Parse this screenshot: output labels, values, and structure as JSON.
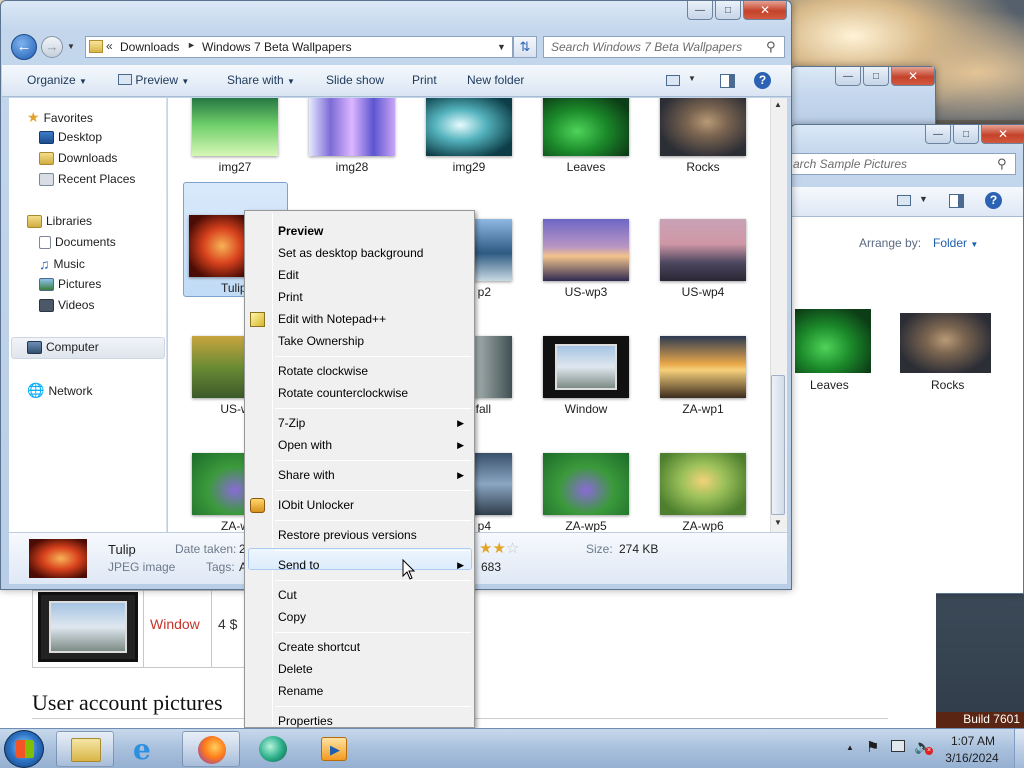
{
  "explorer": {
    "breadcrumb": [
      "Downloads",
      "Windows 7 Beta Wallpapers"
    ],
    "search_placeholder": "Search Windows 7 Beta Wallpapers",
    "toolbar": {
      "organize": "Organize",
      "preview": "Preview",
      "share_with": "Share with",
      "slide_show": "Slide show",
      "print": "Print",
      "new_folder": "New folder"
    },
    "nav": {
      "favorites": "Favorites",
      "desktop": "Desktop",
      "downloads": "Downloads",
      "recent_places": "Recent Places",
      "libraries": "Libraries",
      "documents": "Documents",
      "music": "Music",
      "pictures": "Pictures",
      "videos": "Videos",
      "computer": "Computer",
      "network": "Network"
    },
    "files": [
      {
        "name": "img27"
      },
      {
        "name": "img28"
      },
      {
        "name": "img29"
      },
      {
        "name": "Leaves"
      },
      {
        "name": "Rocks"
      },
      {
        "name": "Tulip"
      },
      {
        "name": "US-wp2"
      },
      {
        "name": "US-wp3"
      },
      {
        "name": "US-wp4"
      },
      {
        "name": "US-wp"
      },
      {
        "name": "US-waterfall"
      },
      {
        "name": "Window"
      },
      {
        "name": "ZA-wp1"
      },
      {
        "name": "ZA-wp"
      },
      {
        "name": "ZA-wp4"
      },
      {
        "name": "ZA-wp5"
      },
      {
        "name": "ZA-wp6"
      }
    ],
    "labels_visible": {
      "img27": "img27",
      "img28": "img28",
      "img29": "img29",
      "leaves": "Leaves",
      "rocks": "Rocks",
      "tulip": "Tulip",
      "uswp2": "p2",
      "uswp3": "US-wp3",
      "uswp4": "US-wp4",
      "uswp1": "US-w",
      "waterfall": "fall",
      "window": "Window",
      "zawp1": "ZA-wp1",
      "zawp3": "ZA-w",
      "zawp4": "p4",
      "zawp5": "ZA-wp5",
      "zawp6": "ZA-wp6"
    },
    "details": {
      "name": "Tulip",
      "type": "JPEG image",
      "date_taken_label": "Date taken:",
      "date_taken_value": "2",
      "tags_label": "Tags:",
      "tags_value": "A",
      "rating_fragment": "683",
      "size_label": "Size:",
      "size_value": "274 KB",
      "rating_stars": 2
    }
  },
  "back_window": {
    "search_placeholder": "arch Sample Pictures",
    "arrange_label": "Arrange by:",
    "arrange_value": "Folder",
    "items": [
      "Leaves",
      "Rocks"
    ]
  },
  "context_menu": {
    "items": [
      {
        "label": "Preview",
        "bold": true
      },
      {
        "label": "Set as desktop background"
      },
      {
        "label": "Edit"
      },
      {
        "label": "Print"
      },
      {
        "label": "Edit with Notepad++",
        "icon": "notepad-icon"
      },
      {
        "label": "Take Ownership"
      },
      {
        "label": "Rotate clockwise"
      },
      {
        "label": "Rotate counterclockwise"
      },
      {
        "label": "7-Zip",
        "submenu": true
      },
      {
        "label": "Open with",
        "submenu": true
      },
      {
        "label": "Share with",
        "submenu": true
      },
      {
        "label": "IObit Unlocker",
        "icon": "unlock-icon"
      },
      {
        "label": "Restore previous versions"
      },
      {
        "label": "Send to",
        "submenu": true,
        "highlighted": true
      },
      {
        "label": "Cut"
      },
      {
        "label": "Copy"
      },
      {
        "label": "Create shortcut"
      },
      {
        "label": "Delete"
      },
      {
        "label": "Rename"
      },
      {
        "label": "Properties"
      }
    ]
  },
  "webpage": {
    "link": "Window",
    "number": "4 $",
    "heading": "User account pictures"
  },
  "build_label": "Build 7601",
  "clock": {
    "time": "1:07 AM",
    "date": "3/16/2024"
  }
}
